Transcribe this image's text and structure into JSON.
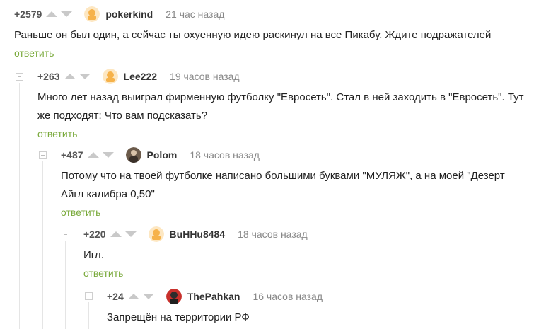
{
  "comments": [
    {
      "rating": "+2579",
      "author": "pokerkind",
      "time": "21 час назад",
      "text": "Раньше он был один, а сейчас ты охуенную идею раскинул на все Пикабу. Ждите подражателей",
      "reply": "ответить",
      "avatar": "default-avatar-icon"
    },
    {
      "rating": "+263",
      "author": "Lee222",
      "time": "19 часов назад",
      "text": "Много лет назад выиграл фирменную футболку \"Евросеть\". Стал в ней заходить в \"Евросеть\". Тут же подходят: Что вам подсказать?",
      "reply": "ответить",
      "avatar": "default-avatar-icon"
    },
    {
      "rating": "+487",
      "author": "Polom",
      "time": "18 часов назад",
      "text": "Потому что на твоей футболке написано большими буквами \"МУЛЯЖ\", а на моей \"Дезерт Айгл калибра 0,50\"",
      "reply": "ответить",
      "avatar": "user-photo-avatar"
    },
    {
      "rating": "+220",
      "author": "BuHHu8484",
      "time": "18 часов назад",
      "text": "Игл.",
      "reply": "ответить",
      "avatar": "default-avatar-icon"
    },
    {
      "rating": "+24",
      "author": "ThePahkan",
      "time": "16 часов назад",
      "text": "Запрещён на территории РФ",
      "reply": "",
      "avatar": "user-photo-avatar"
    }
  ],
  "colors": {
    "reply_link": "#7aaa3c",
    "vote_arrow": "#c9c9c9",
    "time_text": "#888888"
  }
}
